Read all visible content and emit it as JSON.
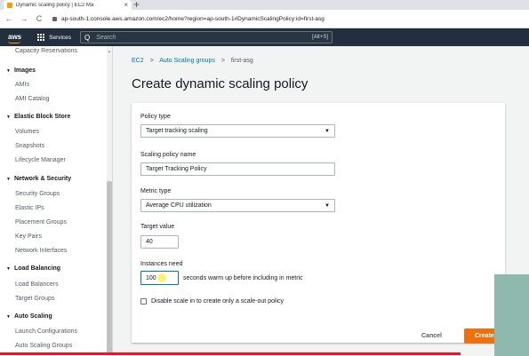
{
  "browser": {
    "tab_title": "Dynamic scaling policy | EC2 Ma",
    "tab_close": "×",
    "new_tab": "+",
    "back": "←",
    "forward": "→",
    "reload": "C",
    "url": "ap-south-1.console.aws.amazon.com/ec2/home?region=ap-south-1#DynamicScalingPolicy:id=first-asg"
  },
  "aws_header": {
    "logo": "aws",
    "services_label": "Services",
    "search_icon": "Q",
    "search_placeholder": "Search",
    "search_shortcut": "[Alt+S]"
  },
  "sidebar": {
    "items": [
      {
        "type": "item",
        "label": "Capacity Reservations"
      },
      {
        "type": "head",
        "label": "Images"
      },
      {
        "type": "item",
        "label": "AMIs"
      },
      {
        "type": "item",
        "label": "AMI Catalog"
      },
      {
        "type": "head",
        "label": "Elastic Block Store"
      },
      {
        "type": "item",
        "label": "Volumes"
      },
      {
        "type": "item",
        "label": "Snapshots"
      },
      {
        "type": "item",
        "label": "Lifecycle Manager"
      },
      {
        "type": "head",
        "label": "Network & Security"
      },
      {
        "type": "item",
        "label": "Security Groups"
      },
      {
        "type": "item",
        "label": "Elastic IPs"
      },
      {
        "type": "item",
        "label": "Placement Groups"
      },
      {
        "type": "item",
        "label": "Key Pairs"
      },
      {
        "type": "item",
        "label": "Network Interfaces"
      },
      {
        "type": "head",
        "label": "Load Balancing"
      },
      {
        "type": "item",
        "label": "Load Balancers"
      },
      {
        "type": "item",
        "label": "Target Groups"
      },
      {
        "type": "head",
        "label": "Auto Scaling"
      },
      {
        "type": "item",
        "label": "Launch Configurations"
      },
      {
        "type": "item",
        "label": "Auto Scaling Groups"
      }
    ],
    "caret": "▼"
  },
  "breadcrumb": {
    "ec2": "EC2",
    "asg": "Auto Scaling groups",
    "current": "first-asg",
    "sep": ">"
  },
  "page_title": "Create dynamic scaling policy",
  "form": {
    "policy_type_label": "Policy type",
    "policy_type_value": "Target tracking scaling",
    "policy_name_label": "Scaling policy name",
    "policy_name_value": "Target Tracking Policy",
    "metric_type_label": "Metric type",
    "metric_type_value": "Average CPU utilization",
    "target_value_label": "Target value",
    "target_value": "40",
    "warmup_label": "Instances need",
    "warmup_value": "100",
    "warmup_suffix": "seconds warm up before including in metric",
    "disable_scalein_label": "Disable scale in to create only a scale-out policy",
    "dropdown_arrow": "▼"
  },
  "actions": {
    "cancel": "Cancel",
    "create": "Create"
  }
}
